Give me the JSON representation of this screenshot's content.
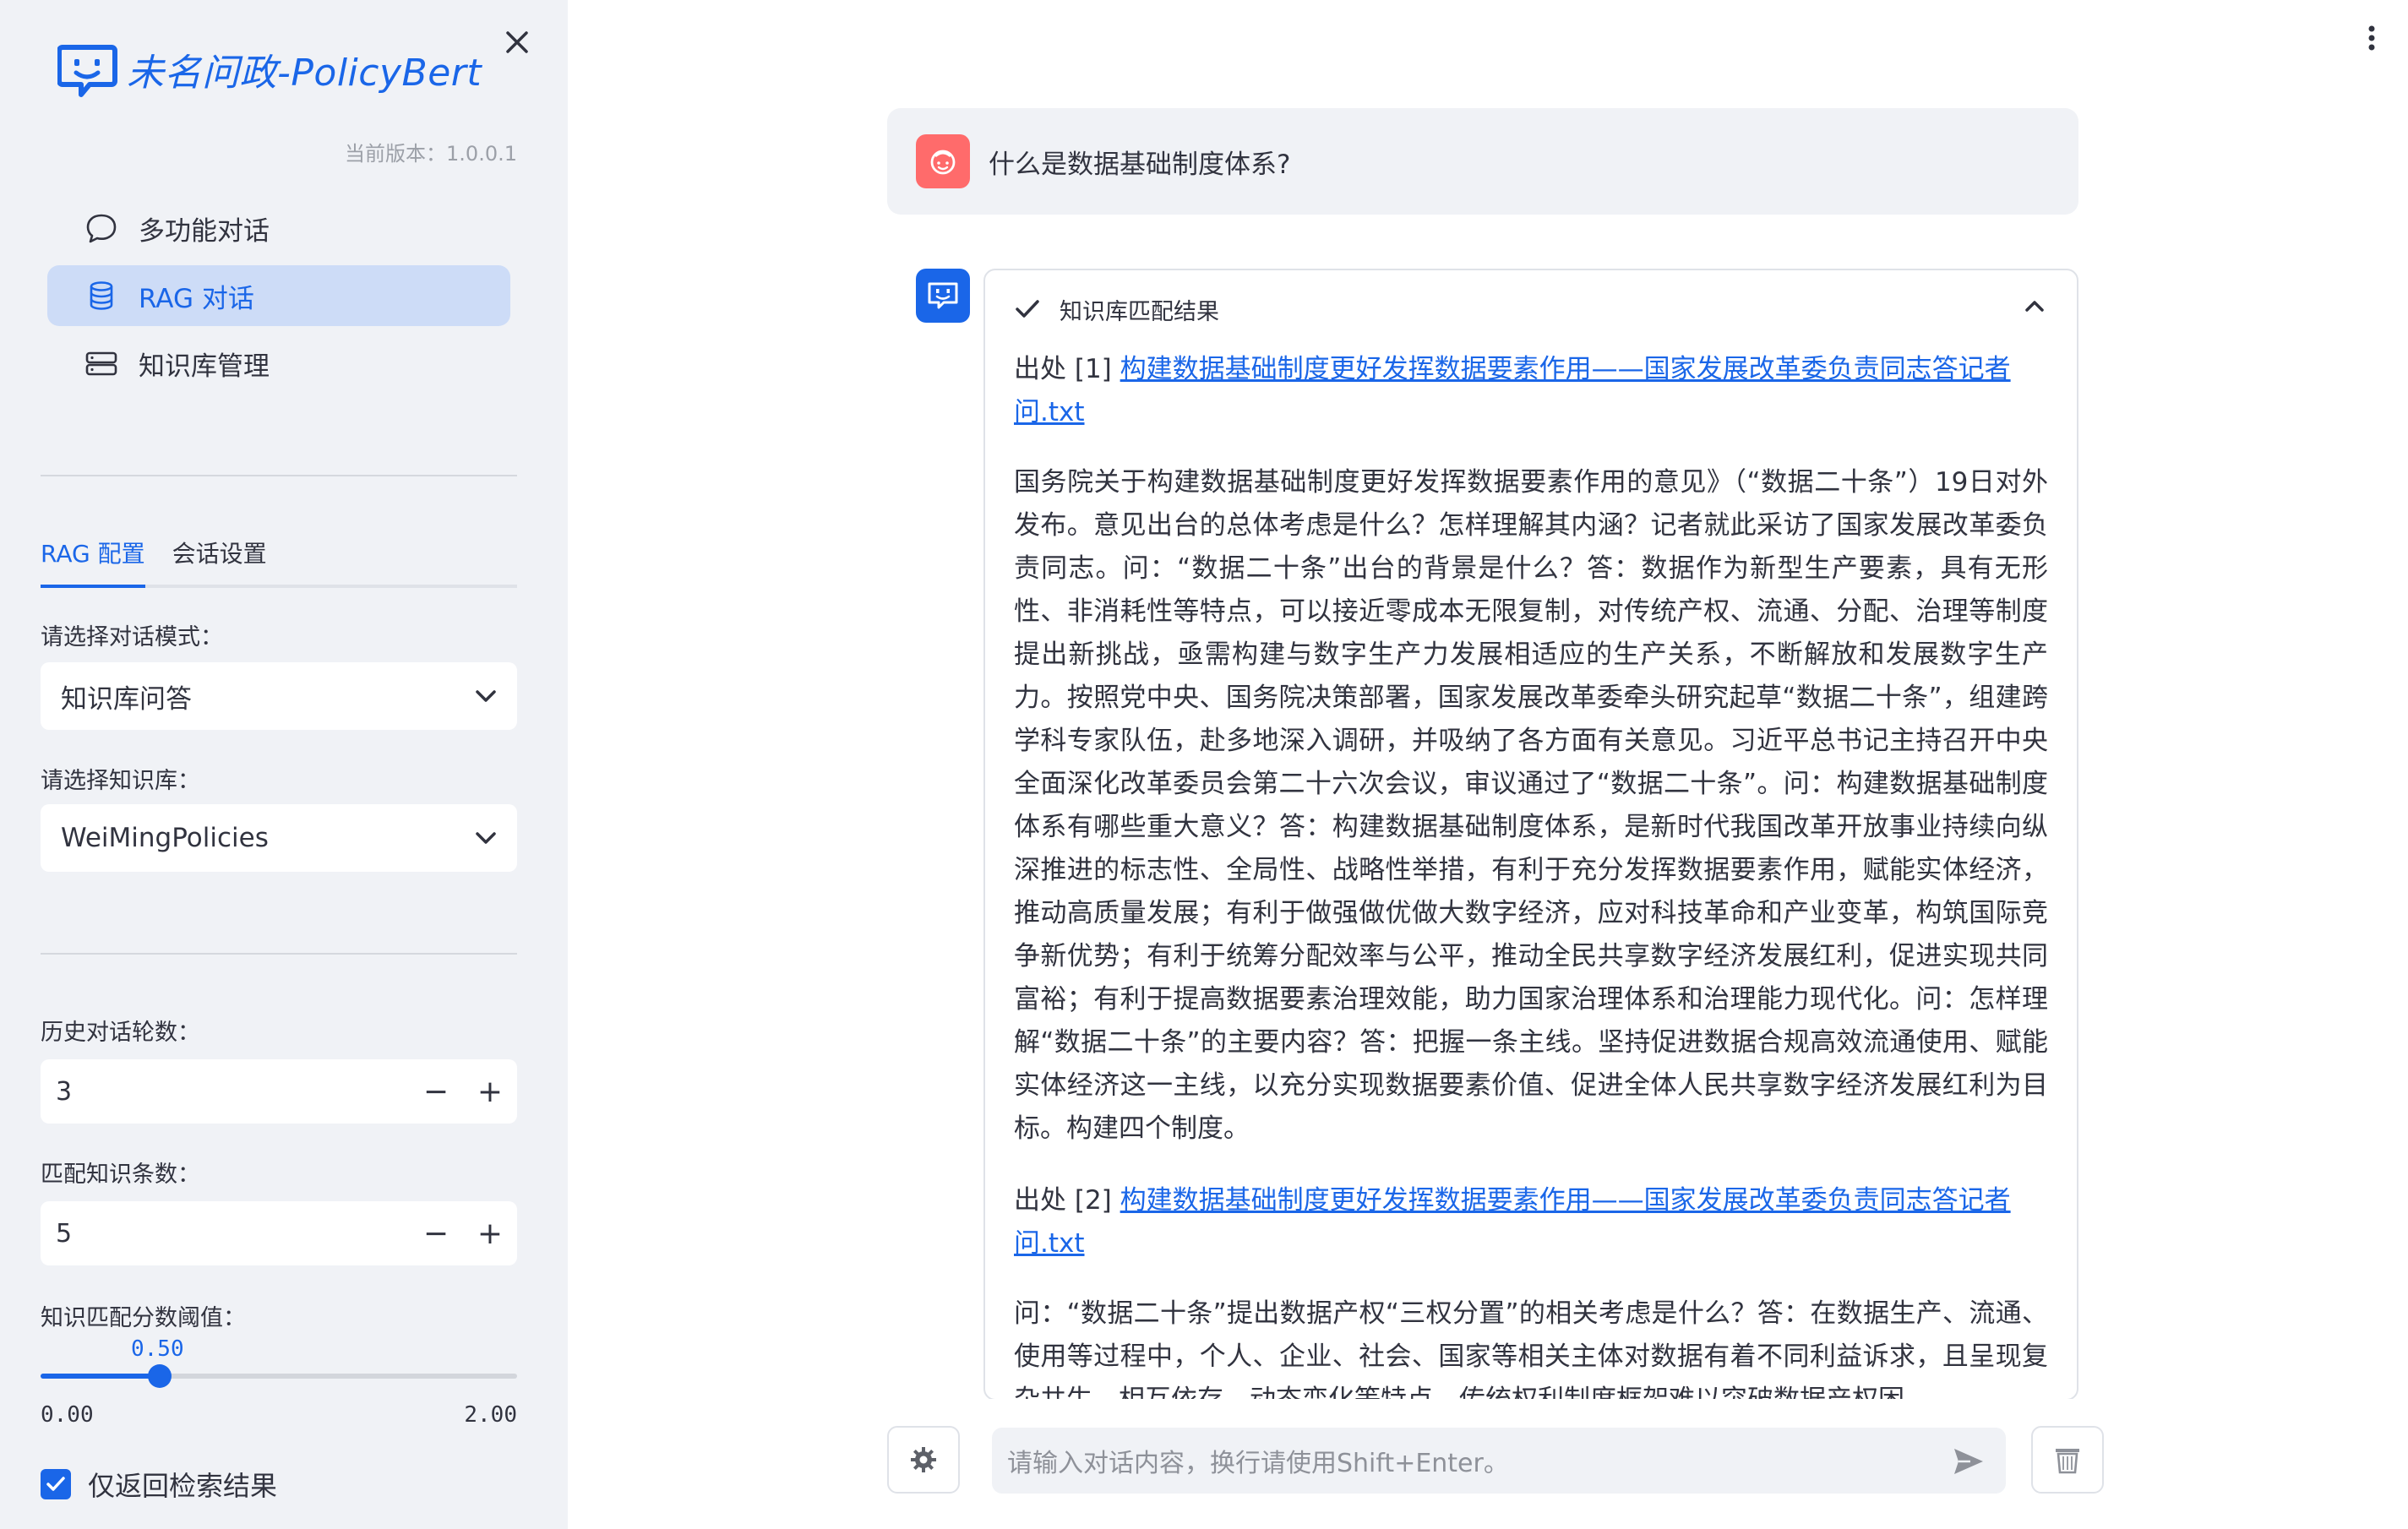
{
  "app": {
    "title": "未名问政-PolicyBert",
    "version_label": "当前版本：1.0.0.1"
  },
  "nav": [
    {
      "label": "多功能对话",
      "icon": "chat-bubble-icon",
      "active": false
    },
    {
      "label": "RAG 对话",
      "icon": "database-icon",
      "active": true
    },
    {
      "label": "知识库管理",
      "icon": "server-icon",
      "active": false
    }
  ],
  "tabs": [
    "RAG 配置",
    "会话设置"
  ],
  "settings": {
    "mode_label": "请选择对话模式：",
    "mode_value": "知识库问答",
    "kb_label": "请选择知识库：",
    "kb_value": "WeiMingPolicies",
    "history_label": "历史对话轮数：",
    "history_value": "3",
    "topk_label": "匹配知识条数：",
    "topk_value": "5",
    "threshold_label": "知识匹配分数阈值：",
    "threshold_value": "0.50",
    "threshold_min": "0.00",
    "threshold_max": "2.00",
    "threshold_fraction": 0.25,
    "retrieval_only_label": "仅返回检索结果",
    "retrieval_only_checked": true
  },
  "steppers": {
    "minus": "−",
    "plus": "+"
  },
  "chat": {
    "user_question": "什么是数据基础制度体系?",
    "expander_title": "知识库匹配结果",
    "sources": [
      {
        "prefix": "出处 [1] ",
        "link": "构建数据基础制度更好发挥数据要素作用——国家发展改革委负责同志答记者问.txt",
        "content": "国务院关于构建数据基础制度更好发挥数据要素作用的意见》（“数据二十条”）19日对外发布。意见出台的总体考虑是什么？怎样理解其内涵？记者就此采访了国家发展改革委负责同志。问：“数据二十条”出台的背景是什么？答：数据作为新型生产要素，具有无形性、非消耗性等特点，可以接近零成本无限复制，对传统产权、流通、分配、治理等制度提出新挑战，亟需构建与数字生产力发展相适应的生产关系，不断解放和发展数字生产力。按照党中央、国务院决策部署，国家发展改革委牵头研究起草“数据二十条”，组建跨学科专家队伍，赴多地深入调研，并吸纳了各方面有关意见。习近平总书记主持召开中央全面深化改革委员会第二十六次会议，审议通过了“数据二十条”。问：构建数据基础制度体系有哪些重大意义？答：构建数据基础制度体系，是新时代我国改革开放事业持续向纵深推进的标志性、全局性、战略性举措，有利于充分发挥数据要素作用，赋能实体经济，推动高质量发展；有利于做强做优做大数字经济，应对科技革命和产业变革，构筑国际竞争新优势；有利于统筹分配效率与公平，推动全民共享数字经济发展红利，促进实现共同富裕；有利于提高数据要素治理效能，助力国家治理体系和治理能力现代化。问：怎样理解“数据二十条”的主要内容？答：把握一条主线。坚持促进数据合规高效流通使用、赋能实体经济这一主线，以充分实现数据要素价值、促进全体人民共享数字经济发展红利为目标。构建四个制度。"
      },
      {
        "prefix": "出处 [2] ",
        "link": "构建数据基础制度更好发挥数据要素作用——国家发展改革委负责同志答记者问.txt",
        "content": "问：“数据二十条”提出数据产权“三权分置”的相关考虑是什么？答：在数据生产、流通、使用等过程中，个人、企业、社会、国家等相关主体对数据有着不同利益诉求，且呈现复杂共生、相互依存、动态变化等特点，传统权利制度框架难以突破数据产权困"
      }
    ],
    "input_placeholder": "请输入对话内容，换行请使用Shift+Enter。"
  },
  "colors": {
    "accent": "#1a66e8",
    "sidebar_bg": "#f0f2f6",
    "nav_active_bg": "#cddcf7",
    "user_avatar": "#ff6b6b"
  }
}
